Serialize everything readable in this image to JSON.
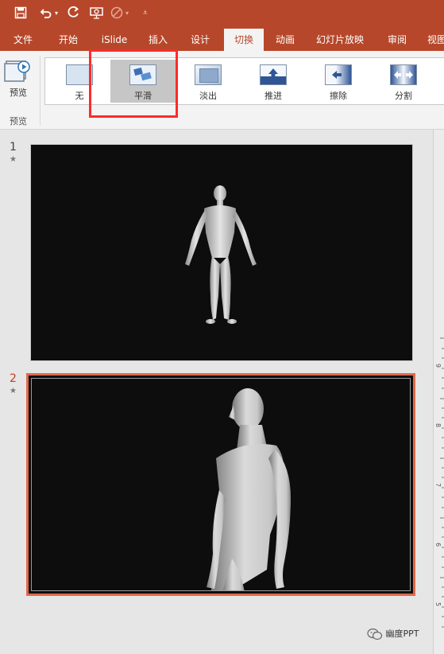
{
  "qat": {
    "icons": [
      "save-icon",
      "undo-icon",
      "dropdown-arrow",
      "redo-icon",
      "present-icon",
      "disabled-icon",
      "customize-icon"
    ]
  },
  "tabs": [
    "文件",
    "开始",
    "iSlide",
    "插入",
    "设计",
    "切换",
    "动画",
    "幻灯片放映",
    "审阅",
    "视图"
  ],
  "active_tab": "切换",
  "ribbon": {
    "preview_label": "预览",
    "group_label": "预览",
    "transitions": [
      {
        "label": "无",
        "icon": "none-transition-icon",
        "selected": false
      },
      {
        "label": "平滑",
        "icon": "morph-transition-icon",
        "selected": true
      },
      {
        "label": "淡出",
        "icon": "fade-transition-icon",
        "selected": false
      },
      {
        "label": "推进",
        "icon": "push-transition-icon",
        "selected": false
      },
      {
        "label": "擦除",
        "icon": "wipe-transition-icon",
        "selected": false
      },
      {
        "label": "分割",
        "icon": "split-transition-icon",
        "selected": false
      }
    ]
  },
  "slides": [
    {
      "number": "1",
      "marker": "★",
      "active": false,
      "content": "standing-human-figure"
    },
    {
      "number": "2",
      "marker": "★",
      "active": true,
      "content": "close-up-human-figure"
    }
  ],
  "ruler": {
    "numbers": [
      "9",
      "8",
      "7",
      "6",
      "5"
    ]
  },
  "watermark": "幽度PPT",
  "colors": {
    "accent": "#b7472a",
    "selected_slide_border": "#e0694a",
    "highlight": "#ff2a2a"
  }
}
